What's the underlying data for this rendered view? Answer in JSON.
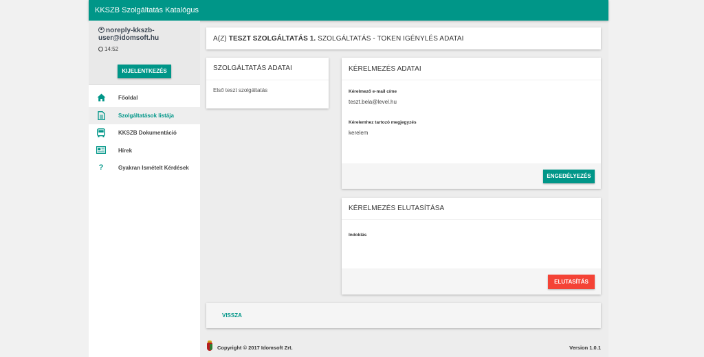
{
  "app": {
    "title": "KKSZB Szolgáltatás Katalógus"
  },
  "user": {
    "email": "noreply-kkszb-user@idomsoft.hu",
    "time": "14:52",
    "logout_label": "KIJELENTKEZÉS"
  },
  "menu": [
    {
      "label": "Főoldal",
      "icon": "home-icon"
    },
    {
      "label": "Szolgáltatások listája",
      "icon": "document-icon",
      "active": true
    },
    {
      "label": "KKSZB Dokumentáció",
      "icon": "bus-icon"
    },
    {
      "label": "Hírek",
      "icon": "newspaper-icon"
    },
    {
      "label": "Gyakran Ismételt Kérdések",
      "icon": "question-icon"
    }
  ],
  "header": {
    "prefix": "A(Z)",
    "service_name": "TESZT SZOLGÁLTATÁS 1.",
    "suffix": "SZOLGÁLTATÁS - TOKEN IGÉNYLÉS ADATAI"
  },
  "service": {
    "title": "SZOLGÁLTATÁS ADATAI",
    "value": "Első teszt szolgáltatás"
  },
  "request": {
    "title": "KÉRELMEZÉS ADATAI",
    "email_label": "Kérelmező e-mail címe",
    "email_value": "teszt.bela@level.hu",
    "note_label": "Kérelemhez tartozó megjegyzés",
    "note_value": "kerelem",
    "approve_label": "ENGEDÉLYEZÉS"
  },
  "rejection": {
    "title": "KÉRELMEZÉS ELUTASÍTÁSA",
    "reason_label": "Indoklás",
    "reject_label": "ELUTASÍTÁS"
  },
  "back_label": "VISSZA",
  "footer": {
    "copyright": "Copyright © 2017 Idomsoft Zrt.",
    "version": "Version 1.0.1"
  },
  "colors": {
    "primary": "#009688",
    "danger": "#f44336"
  }
}
